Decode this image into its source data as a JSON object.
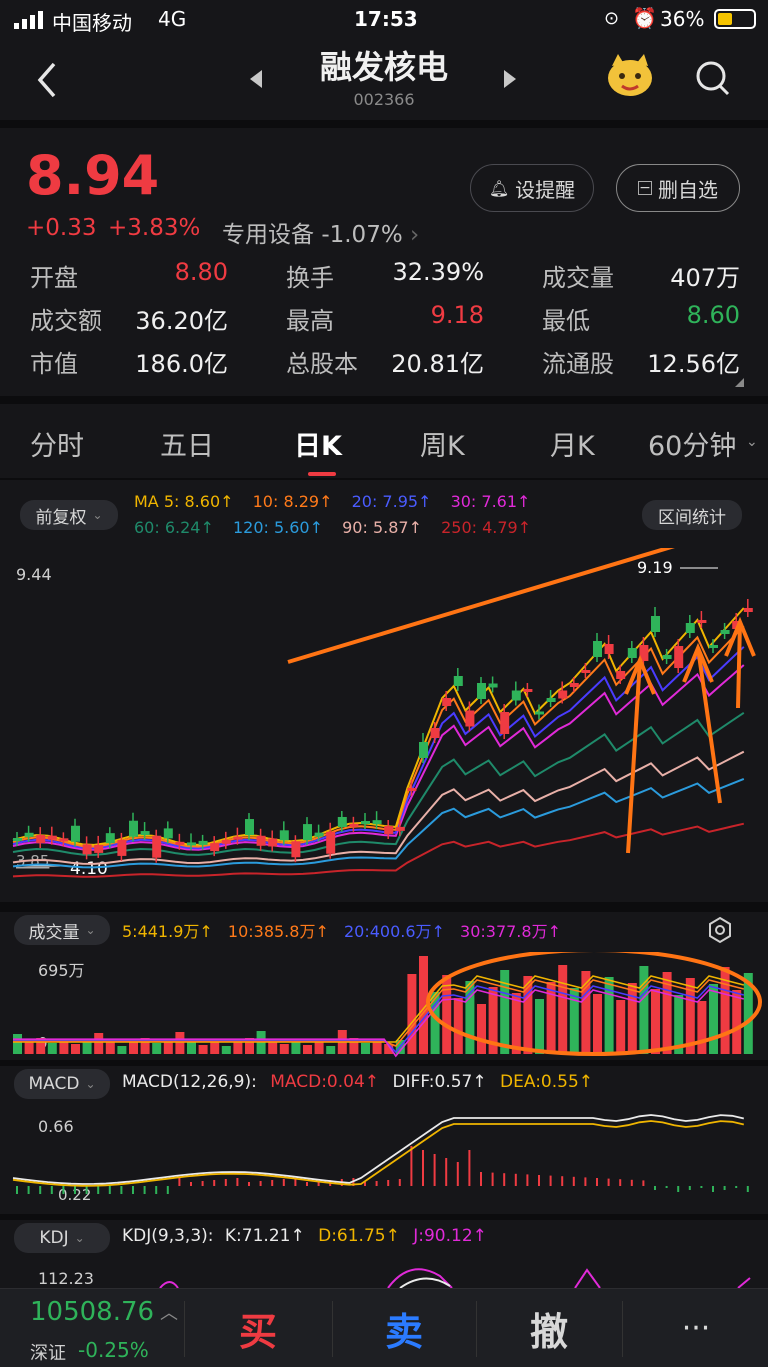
{
  "status_bar": {
    "carrier": "中国移动",
    "network": "4G",
    "time": "17:53",
    "battery": "36%"
  },
  "header": {
    "name": "融发核电",
    "code": "002366"
  },
  "quote": {
    "price": "8.94",
    "change": "+0.33",
    "change_pct": "+3.83%",
    "sector": "专用设备",
    "sector_change": "-1.07%",
    "alert_btn": "设提醒",
    "remove_btn": "删自选"
  },
  "stats": [
    [
      {
        "label": "开盘",
        "value": "8.80",
        "color": "red"
      },
      {
        "label": "换手",
        "value": "32.39%",
        "color": "white"
      },
      {
        "label": "成交量",
        "value": "407万",
        "color": "white"
      }
    ],
    [
      {
        "label": "成交额",
        "value": "36.20亿",
        "color": "white"
      },
      {
        "label": "最高",
        "value": "9.18",
        "color": "red"
      },
      {
        "label": "最低",
        "value": "8.60",
        "color": "green"
      }
    ],
    [
      {
        "label": "市值",
        "value": "186.0亿",
        "color": "white"
      },
      {
        "label": "总股本",
        "value": "20.81亿",
        "color": "white"
      },
      {
        "label": "流通股",
        "value": "12.56亿",
        "color": "white"
      }
    ]
  ],
  "tabs": [
    "分时",
    "五日",
    "日K",
    "周K",
    "月K",
    "60分钟"
  ],
  "active_tab": "日K",
  "kline": {
    "adjust": "前复权",
    "range_btn": "区间统计",
    "ma": [
      "MA 5: 8.60↑",
      "10: 8.29↑",
      "20: 7.95↑",
      "30: 7.61↑",
      "60: 6.24↑",
      "120: 5.60↑",
      "90: 5.87↑",
      "250: 4.79↑"
    ],
    "y_top": "9.44",
    "y_bottom": "3.85",
    "low_label": "4.10",
    "high_label": "9.19"
  },
  "volume": {
    "label": "成交量",
    "ma": [
      "5:441.9万↑",
      "10:385.8万↑",
      "20:400.6万↑",
      "30:377.8万↑"
    ],
    "y_top": "695万",
    "y_zero": "0"
  },
  "macd": {
    "label": "MACD",
    "params": "MACD(12,26,9):",
    "macd": "MACD:0.04↑",
    "diff": "DIFF:0.57↑",
    "dea": "DEA:0.55↑",
    "y_top": "0.66",
    "y_low": "0.22"
  },
  "kdj": {
    "label": "KDJ",
    "params": "KDJ(9,3,3):",
    "k": "K:71.21↑",
    "d": "D:61.75↑",
    "j": "J:90.12↑",
    "y_top": "112.23"
  },
  "bottom": {
    "index_value": "10508.76",
    "index_name": "深证",
    "index_change": "-0.25%",
    "buy": "买",
    "sell": "卖",
    "cancel": "撤",
    "more": "···"
  },
  "colors": {
    "up": "#ef3b42",
    "down": "#2fb35a",
    "ma5": "#f0b500",
    "ma10": "#ff7a1a",
    "ma20": "#4a3cff",
    "ma30": "#e02ad8",
    "ma60": "#1f8a6a",
    "ma120": "#2b9bdc",
    "ma90": "#e8b0a8",
    "ma250": "#c8242a",
    "annotation": "#ff7414"
  }
}
